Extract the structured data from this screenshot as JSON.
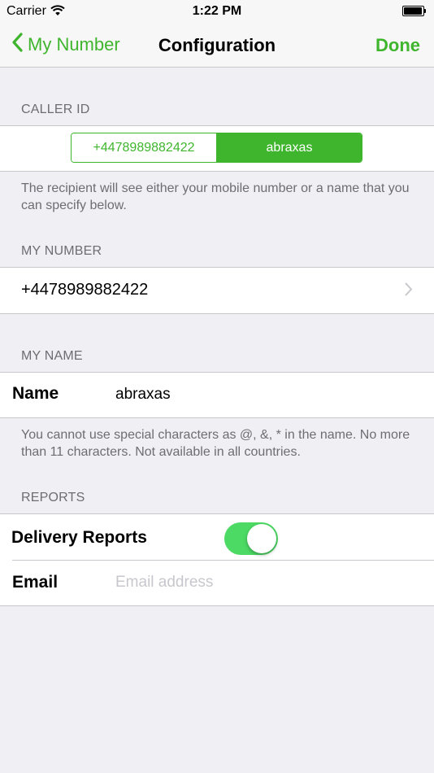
{
  "status_bar": {
    "carrier": "Carrier",
    "time": "1:22 PM"
  },
  "nav": {
    "back_label": "My Number",
    "title": "Configuration",
    "done_label": "Done"
  },
  "caller_id": {
    "header": "CALLER ID",
    "segments": [
      "+4478989882422",
      "abraxas"
    ],
    "selected_index": 1,
    "footer": "The recipient will see either your mobile number or a name that you can specify below."
  },
  "my_number": {
    "header": "MY NUMBER",
    "value": "+4478989882422"
  },
  "my_name": {
    "header": "MY NAME",
    "label": "Name",
    "value": "abraxas",
    "footer": "You cannot use special characters as @, &, * in the name. No more than 11 characters. Not available in all countries."
  },
  "reports": {
    "header": "REPORTS",
    "delivery_label": "Delivery Reports",
    "delivery_on": true,
    "email_label": "Email",
    "email_value": "",
    "email_placeholder": "Email address"
  },
  "colors": {
    "accent": "#3fb52e",
    "toggle_on": "#4cd964",
    "background": "#efeff4"
  }
}
